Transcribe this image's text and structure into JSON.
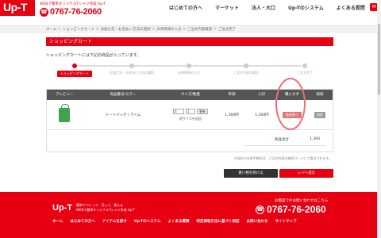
{
  "header": {
    "logo": "Up-T",
    "tagline": "WEBで簡単オリジナルTシャツ作成 Up-T",
    "phone": "0767-76-2060",
    "nav": [
      "はじめての方へ",
      "マーケット",
      "法人・大口",
      "Up-Tのシステム",
      "よくある質問"
    ]
  },
  "breadcrumb": "ホーム ＞ ショッピングカート ＞ お届け先・お支払い方法の選択 ＞ 決済情報の入力 ＞ ご注文内容確認 ＞ ご注文完了",
  "title": "ショッピングカート",
  "intro": "ショッピングカートには下記の商品が入っています。",
  "steps": [
    "ショッピングカート",
    "お届け先・お支払い方法の選択",
    "決済情報の入力",
    "ご注文内容の確認",
    "ご注文完了"
  ],
  "table": {
    "headers": [
      "プレビュー",
      "商品番号/カラー",
      "サイズ/数量",
      "単価",
      "小計",
      "購入せず",
      "削除"
    ],
    "row": {
      "product": "トートバッグ / ライム",
      "size": "S",
      "qty": "1",
      "update": "更新",
      "size_note": "他サイズを追加",
      "unit_price": "1,300円",
      "subtotal": "1,300円",
      "buy_later": "後程買う",
      "delete": "削除"
    },
    "sum_label": "商品合計",
    "sum_value": "1,300"
  },
  "note": "※送料や決済手数料は、ご注文内容の確認ページにて算出されます。",
  "buttons": {
    "continue": "買い物を続ける",
    "checkout": "レジへ進む"
  },
  "footer": {
    "logo": "Up-T",
    "tag_line1": "簡単でつくって、売って、買える",
    "tag_line2": "WEBで簡単オリジナルTシャツ作成 Up-T",
    "contact_title": "お電話でのお問い合わせはこちら",
    "phone": "0767-76-2060",
    "nav": [
      "ホーム",
      "はじめての方へ",
      "アイテムを探す",
      "Up-Tのシステム",
      "よくある質問",
      "特定商取引法に基づく表記",
      "お問い合わせ",
      "サイトマップ"
    ]
  }
}
